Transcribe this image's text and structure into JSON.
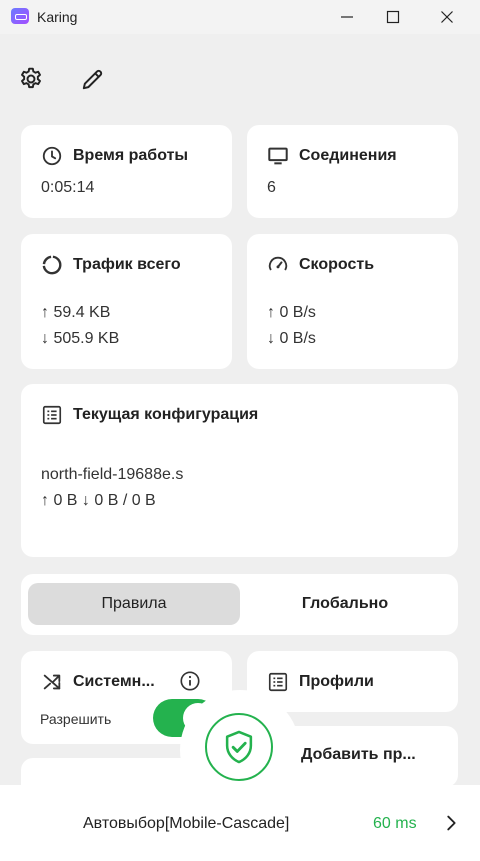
{
  "window": {
    "title": "Karing"
  },
  "cards": {
    "uptime": {
      "title": "Время работы",
      "value": "0:05:14"
    },
    "connections": {
      "title": "Соединения",
      "value": "6"
    },
    "traffic": {
      "title": "Трафик всего",
      "up": "↑ 59.4 KB",
      "down": "↓ 505.9 KB"
    },
    "speed": {
      "title": "Скорость",
      "up": "↑ 0 B/s",
      "down": "↓ 0 B/s"
    },
    "config": {
      "title": "Текущая конфигурация",
      "name": "north-field-19688e.s",
      "stats": "↑ 0 B ↓ 0 B / 0 B"
    }
  },
  "mode": {
    "rules_label": "Правила",
    "global_label": "Глобально",
    "selected": "rules"
  },
  "system_proxy": {
    "title": "Системн...",
    "allow_label": "Разрешить",
    "enabled": true
  },
  "profiles": {
    "title": "Профили"
  },
  "add_profile": {
    "title": "Добавить пр..."
  },
  "bottom": {
    "server": "Автовыбор[Mobile-Cascade]",
    "ping": "60 ms"
  },
  "colors": {
    "accent": "#24b24e",
    "background": "#efefef",
    "card": "#ffffff"
  }
}
